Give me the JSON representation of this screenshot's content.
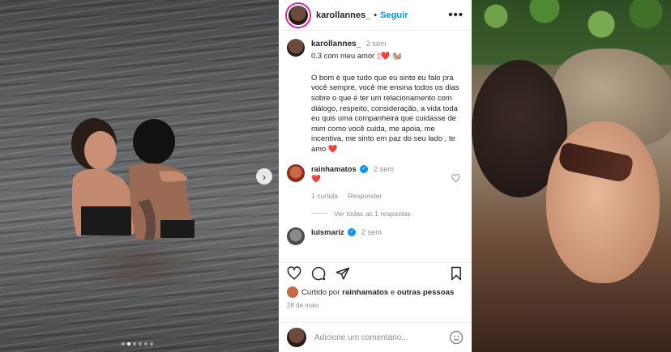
{
  "header": {
    "username": "karollannes_",
    "separator": "•",
    "follow_label": "Seguir",
    "more_label": "•••"
  },
  "caption": {
    "username": "karollannes_",
    "time": "2 sem",
    "title": "0.3 com meu amor",
    "title_emoji": "▯❤️ 🐿️",
    "body": "O bom é que tudo que eu sinto eu falo pra você sempre, você me ensina todos os dias sobre o que é ter um relacionamento com diálogo, respeito, consideração, a vida toda eu quis uma companheira que cuidasse de mim como você cuida, me apoia, me incentiva, me sinto em paz do seu lado , te amo",
    "body_emoji": "❤️"
  },
  "comments": [
    {
      "username": "rainhamatos",
      "verified_mark": "✓",
      "time": "2 sem",
      "text": "❤️",
      "likes_label": "1 curtida",
      "reply_label": "Responder",
      "view_replies": "Ver todas as 1 respostas"
    },
    {
      "username": "luismariz",
      "verified_mark": "✓",
      "time": "2 sem"
    }
  ],
  "likes": {
    "prefix": "Curtido por",
    "first_user": "rainhamatos",
    "connector": "e",
    "others": "outras pessoas"
  },
  "date": "28 de maio",
  "add_comment": {
    "placeholder": "Adicione um comentário..."
  },
  "left_photo": {
    "next_glyph": "›",
    "carousel_count": 6,
    "carousel_active": 1
  },
  "colors": {
    "follow_blue": "#0095f6",
    "heart_red": "#ed4956",
    "muted_gray": "#8e8e8e"
  },
  "icons": {
    "like": "heart-icon",
    "comment": "comment-icon",
    "share": "send-icon",
    "save": "bookmark-icon",
    "emoji": "smiley-icon"
  }
}
